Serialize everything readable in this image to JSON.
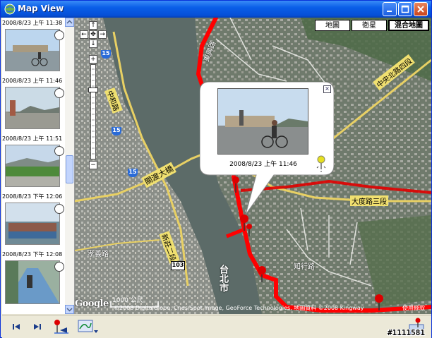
{
  "window": {
    "title": "Map View"
  },
  "photos": [
    {
      "caption": "2008/8/23 上午 11:38"
    },
    {
      "caption": "2008/8/23 上午 11:46"
    },
    {
      "caption": "2008/8/23 上午 11:51"
    },
    {
      "caption": "2008/8/23 下午 12:06"
    },
    {
      "caption": "2008/8/23 下午 12:08"
    }
  ],
  "map": {
    "types": [
      "地圖",
      "衛星",
      "混合地圖"
    ],
    "active_type": "混合地圖",
    "zoom_level_fraction": 0.1,
    "popup": {
      "caption": "2008/8/23 上午 11:46"
    },
    "scale_label": "1000 公尺",
    "copyright": "©2008 DigitalGlobe, Cnes/Spot Image, GeoForce Technologies, 地圖資料 ©2008 Kingway",
    "terms": "使用條款",
    "logo": "Google",
    "road_labels": {
      "guandu_bridge": "關渡大橋",
      "daduroad": "大度路三段",
      "zhongyang_north": "中央北路四段",
      "zhixing": "知行路",
      "taipei": "台北市",
      "xiaoyi": "孝義路",
      "dongxing": "東興路",
      "zhonghe": "中和路",
      "xinzhuang": "新莊二段"
    },
    "route_numbers": [
      "15",
      "15",
      "15",
      "103"
    ]
  },
  "watermark": "#1111581",
  "colors": {
    "route": "#ff0000",
    "titlebar": "#0a5ee8",
    "water": "#5c6b68"
  }
}
